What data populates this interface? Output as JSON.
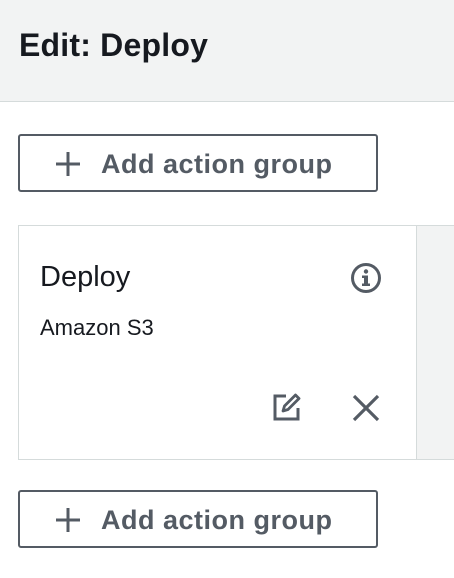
{
  "header": {
    "title": "Edit: Deploy"
  },
  "stage": {
    "add_action_group_top_label": "Add action group",
    "add_action_group_bottom_label": "Add action group",
    "action": {
      "name": "Deploy",
      "provider": "Amazon S3"
    }
  },
  "icons": {
    "plus": "plus-icon",
    "info": "info-icon",
    "edit": "edit-icon",
    "close": "close-icon"
  },
  "colors": {
    "text": "#16191f",
    "button_text": "#545b64",
    "border": "#d5dbdb",
    "header_bg": "#f2f3f3"
  }
}
